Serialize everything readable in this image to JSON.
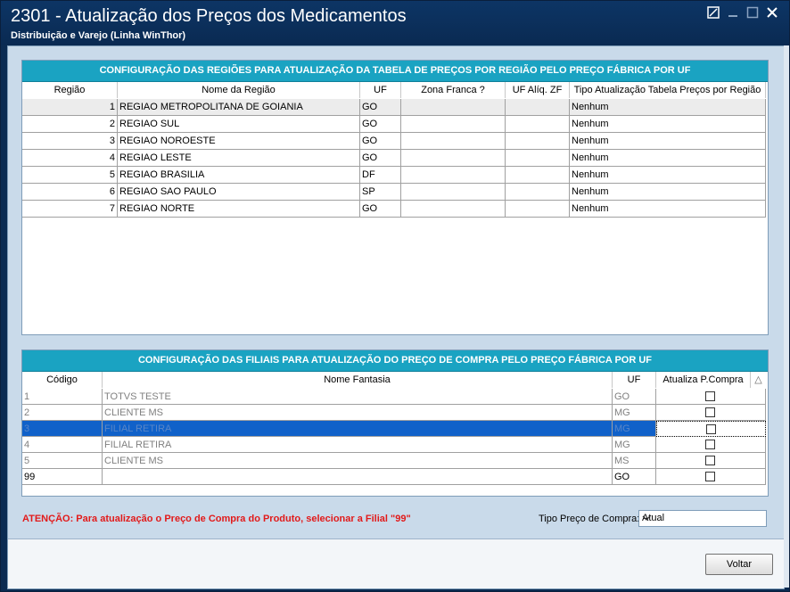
{
  "window": {
    "title": "2301 - Atualização dos Preços dos Medicamentos",
    "subtitle": "Distribuição e Varejo (Linha WinThor)"
  },
  "regions": {
    "header": "CONFIGURAÇÃO DAS REGIÕES PARA ATUALIZAÇÃO DA TABELA DE PREÇOS POR REGIÃO PELO PREÇO FÁBRICA POR UF",
    "columns": [
      "Região",
      "Nome da Região",
      "UF",
      "Zona Franca ?",
      "UF Alíq. ZF",
      "Tipo Atualização Tabela Preços por Região"
    ],
    "rows": [
      {
        "id": "1",
        "name": "REGIAO METROPOLITANA DE GOIANIA",
        "uf": "GO",
        "zf": "",
        "ufzf": "",
        "tipo": "Nenhum"
      },
      {
        "id": "2",
        "name": "REGIAO SUL",
        "uf": "GO",
        "zf": "",
        "ufzf": "",
        "tipo": "Nenhum"
      },
      {
        "id": "3",
        "name": "REGIAO NOROESTE",
        "uf": "GO",
        "zf": "",
        "ufzf": "",
        "tipo": "Nenhum"
      },
      {
        "id": "4",
        "name": "REGIAO LESTE",
        "uf": "GO",
        "zf": "",
        "ufzf": "",
        "tipo": "Nenhum"
      },
      {
        "id": "5",
        "name": "REGIAO BRASILIA",
        "uf": "DF",
        "zf": "",
        "ufzf": "",
        "tipo": "Nenhum"
      },
      {
        "id": "6",
        "name": "REGIAO SAO PAULO",
        "uf": "SP",
        "zf": "",
        "ufzf": "",
        "tipo": "Nenhum"
      },
      {
        "id": "7",
        "name": "REGIAO NORTE",
        "uf": "GO",
        "zf": "",
        "ufzf": "",
        "tipo": "Nenhum"
      }
    ]
  },
  "branches": {
    "header": "CONFIGURAÇÃO DAS FILIAIS PARA ATUALIZAÇÃO DO PREÇO DE COMPRA PELO PREÇO FÁBRICA POR UF",
    "columns": [
      "Código",
      "Nome Fantasia",
      "UF",
      "Atualiza P.Compra"
    ],
    "sort_indicator": "△",
    "rows": [
      {
        "code": "1",
        "name": "TOTVS TESTE",
        "uf": "GO",
        "checked": false
      },
      {
        "code": "2",
        "name": "CLIENTE MS",
        "uf": "MG",
        "checked": false
      },
      {
        "code": "3",
        "name": "FILIAL RETIRA",
        "uf": "MG",
        "checked": false
      },
      {
        "code": "4",
        "name": "FILIAL RETIRA",
        "uf": "MG",
        "checked": false
      },
      {
        "code": "5",
        "name": "CLIENTE MS",
        "uf": "MS",
        "checked": false
      },
      {
        "code": "99",
        "name": "",
        "uf": "GO",
        "checked": false
      }
    ]
  },
  "warning": "ATENÇÃO: Para atualização o Preço de Compra do Produto, selecionar a Filial \"99\"",
  "tipo_preco": {
    "label": "Tipo Preço de Compra:",
    "value": "Atual"
  },
  "buttons": {
    "voltar": "Voltar"
  }
}
